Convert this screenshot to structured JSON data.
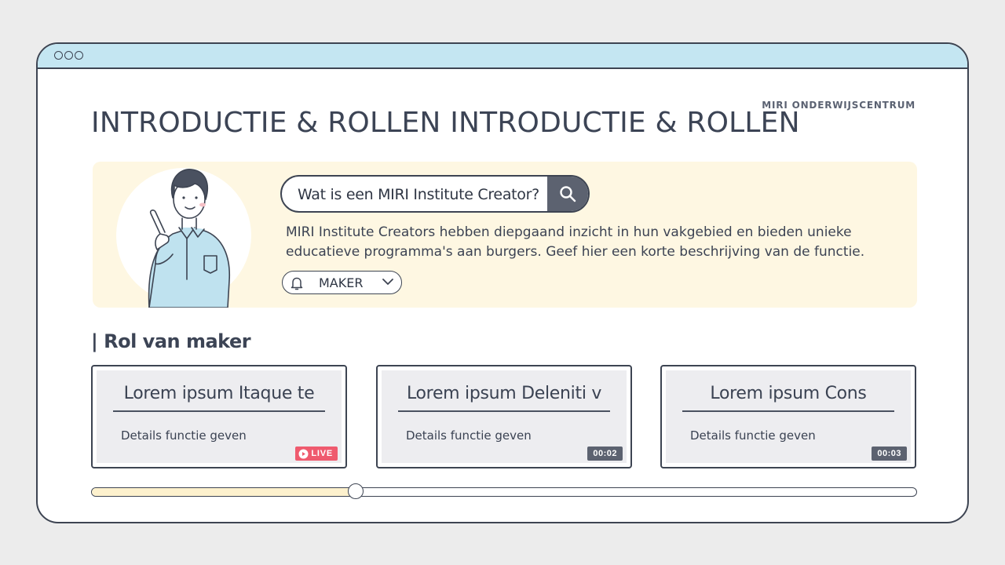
{
  "header": {
    "brand": "MIRI ONDERWIJSCENTRUM",
    "title": "INTRODUCTIE & ROLLEN INTRODUCTIE & ROLLEN"
  },
  "hero": {
    "search_value": "Wat is een MIRI Institute Creator?",
    "description": "MIRI Institute Creators hebben diepgaand inzicht in hun vakgebied en bieden unieke educatieve programma's aan burgers. Geef hier een korte beschrijving van de functie.",
    "role_label": "MAKER"
  },
  "section": {
    "title": "| Rol van maker"
  },
  "cards": [
    {
      "title": "Lorem ipsum Itaque te",
      "detail": "Details functie geven",
      "badge": "LIVE"
    },
    {
      "title": "Lorem ipsum Deleniti v",
      "detail": "Details functie geven",
      "badge": "00:02"
    },
    {
      "title": "Lorem ipsum Cons",
      "detail": "Details functie geven",
      "badge": "00:03"
    }
  ],
  "slider": {
    "progress": 0.32
  },
  "colors": {
    "titlebar": "#c4e6f2",
    "hero_bg": "#fef7e2",
    "card_bg": "#ededf0",
    "live": "#ef5a6e",
    "time_badge": "#5c6270",
    "outline": "#3d4452"
  },
  "icons": {
    "window_controls": "circle-outline",
    "search": "search-icon",
    "role": "bell-icon",
    "dropdown": "chevron-down-icon",
    "live": "play-circle-icon"
  }
}
